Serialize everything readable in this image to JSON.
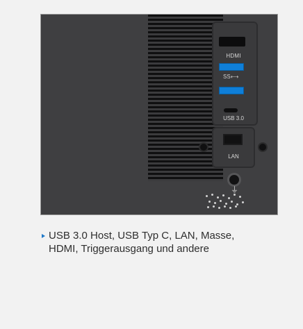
{
  "ports": {
    "hdmi_label": "HDMI",
    "usb_superspeed_mark": "SS⟷",
    "usb_section_label": "USB 3.0",
    "lan_label": "LAN",
    "ground_symbol": "⏚"
  },
  "description": {
    "text": "USB 3.0 Host, USB Typ C, LAN, Masse, HDMI, Triggerausgang und andere"
  },
  "colors": {
    "background": "#f2f2f2",
    "device_body": "#3f3f41",
    "usb_blue": "#0f7fd9",
    "bullet_blue": "#1f78c8",
    "text": "#2e2e2e"
  }
}
